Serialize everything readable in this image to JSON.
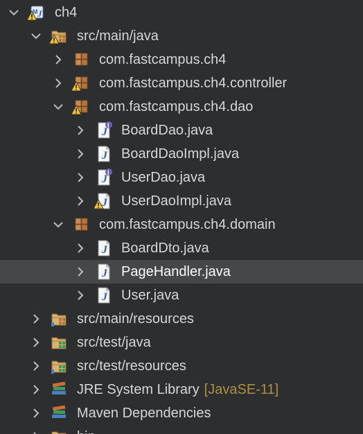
{
  "explorer": {
    "items": [
      {
        "label": "ch4",
        "icon": "java-project-icon",
        "expanded": true,
        "badge": "warning",
        "selected": false
      },
      {
        "label": "src/main/java",
        "icon": "source-folder-icon",
        "expanded": true,
        "badge": "warning",
        "selected": false
      },
      {
        "label": "com.fastcampus.ch4",
        "icon": "package-icon",
        "expanded": false,
        "badge": "",
        "selected": false
      },
      {
        "label": "com.fastcampus.ch4.controller",
        "icon": "package-icon",
        "expanded": false,
        "badge": "warning",
        "selected": false
      },
      {
        "label": "com.fastcampus.ch4.dao",
        "icon": "package-icon",
        "expanded": true,
        "badge": "warning",
        "selected": false
      },
      {
        "label": "BoardDao.java",
        "icon": "java-interface-file-icon",
        "expanded": false,
        "badge": "",
        "selected": false
      },
      {
        "label": "BoardDaoImpl.java",
        "icon": "java-file-icon",
        "expanded": false,
        "badge": "",
        "selected": false
      },
      {
        "label": "UserDao.java",
        "icon": "java-interface-file-icon",
        "expanded": false,
        "badge": "",
        "selected": false
      },
      {
        "label": "UserDaoImpl.java",
        "icon": "java-file-icon",
        "expanded": false,
        "badge": "warning",
        "selected": false
      },
      {
        "label": "com.fastcampus.ch4.domain",
        "icon": "package-icon",
        "expanded": true,
        "badge": "",
        "selected": false
      },
      {
        "label": "BoardDto.java",
        "icon": "java-file-icon",
        "expanded": false,
        "badge": "",
        "selected": false
      },
      {
        "label": "PageHandler.java",
        "icon": "java-file-icon",
        "expanded": false,
        "badge": "",
        "selected": true
      },
      {
        "label": "User.java",
        "icon": "java-file-icon",
        "expanded": false,
        "badge": "",
        "selected": false
      },
      {
        "label": "src/main/resources",
        "icon": "resource-folder-icon",
        "expanded": false,
        "badge": "",
        "selected": false
      },
      {
        "label": "src/test/java",
        "icon": "test-source-folder-icon",
        "expanded": false,
        "badge": "",
        "selected": false
      },
      {
        "label": "src/test/resources",
        "icon": "test-resource-folder-icon",
        "expanded": false,
        "badge": "",
        "selected": false
      },
      {
        "label": "JRE System Library",
        "decoration": "[JavaSE-11]",
        "icon": "library-icon",
        "expanded": false,
        "badge": "",
        "selected": false
      },
      {
        "label": "Maven Dependencies",
        "icon": "library-icon",
        "expanded": false,
        "badge": "",
        "selected": false
      },
      {
        "label": "bin",
        "icon": "folder-icon",
        "expanded": false,
        "badge": "",
        "selected": false
      }
    ]
  },
  "colors": {
    "background": "#2d2e2f",
    "selection": "#464749",
    "text": "#d6d6d6",
    "decoration": "#b0903f",
    "warning": "#f2c23c",
    "interface_badge": "#6b5fb5"
  }
}
